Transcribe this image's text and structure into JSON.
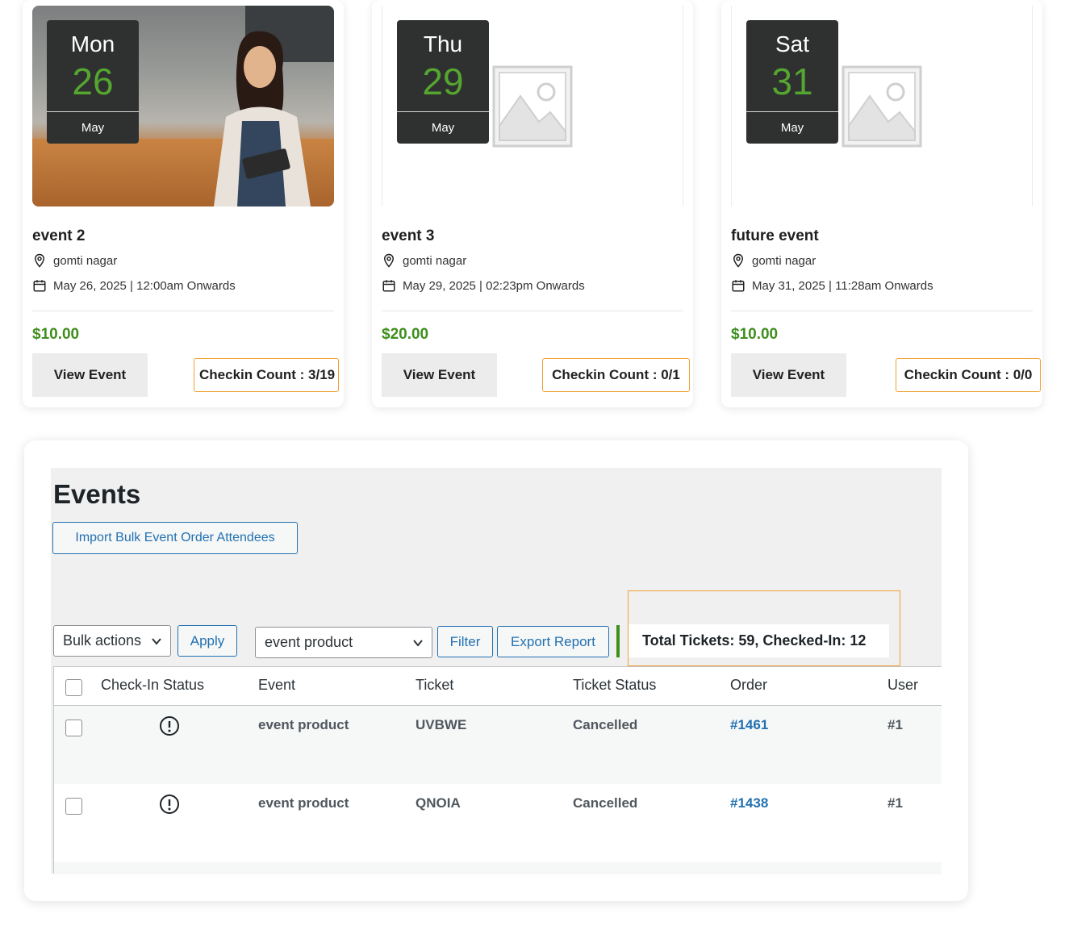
{
  "events": [
    {
      "weekday": "Mon",
      "day": "26",
      "month": "May",
      "title": "event 2",
      "location": "gomti nagar",
      "datetime": "May 26, 2025 | 12:00am Onwards",
      "price": "$10.00",
      "view_label": "View Event",
      "checkin_label": "Checkin Count : 3/19",
      "image": "photo-barista"
    },
    {
      "weekday": "Thu",
      "day": "29",
      "month": "May",
      "title": "event 3",
      "location": "gomti nagar",
      "datetime": "May 29, 2025 | 02:23pm Onwards",
      "price": "$20.00",
      "view_label": "View Event",
      "checkin_label": "Checkin Count : 0/1",
      "image": "placeholder-image-icon"
    },
    {
      "weekday": "Sat",
      "day": "31",
      "month": "May",
      "title": "future event",
      "location": "gomti nagar",
      "datetime": "May 31, 2025 | 11:28am Onwards",
      "price": "$10.00",
      "view_label": "View Event",
      "checkin_label": "Checkin Count : 0/0",
      "image": "placeholder-image-icon"
    }
  ],
  "admin": {
    "title": "Events",
    "import_label": "Import Bulk Event Order Attendees",
    "bulk_actions": "Bulk actions",
    "apply_label": "Apply",
    "event_filter": "event product",
    "filter_label": "Filter",
    "export_label": "Export Report",
    "totals": "Total Tickets: 59, Checked-In: 12",
    "columns": [
      "Check-In Status",
      "Event",
      "Ticket",
      "Ticket Status",
      "Order",
      "User"
    ],
    "rows": [
      {
        "event": "event product",
        "ticket": "UVBWE",
        "status": "Cancelled",
        "order": "#1461",
        "user": "#1"
      },
      {
        "event": "event product",
        "ticket": "QNOIA",
        "status": "Cancelled",
        "order": "#1438",
        "user": "#1"
      }
    ]
  },
  "colors": {
    "accent_green": "#3f8f1e",
    "highlight_orange": "#f0a030",
    "wp_blue": "#2271b1",
    "badge_bg": "#2f3030"
  }
}
